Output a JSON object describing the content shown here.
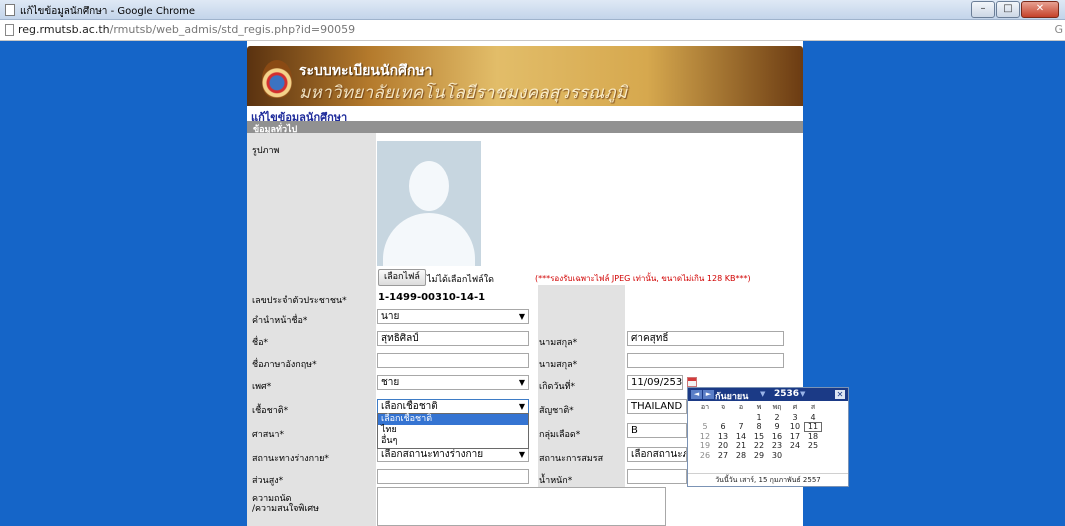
{
  "window": {
    "title": "แก้ไขข้อมูลนักศึกษา - Google Chrome",
    "min": "–",
    "max": "□",
    "close": "✕"
  },
  "address": {
    "host": "reg.rmutsb.ac.th",
    "path": "/rmutsb/web_admis/std_regis.php?id=90059",
    "edge": "G"
  },
  "banner": {
    "title": "ระบบทะเบียนนักศึกษา",
    "subtitle": "มหาวิทยาลัยเทคโนโลยีราชมงคลสุวรรณภูมิ"
  },
  "page": {
    "heading": "แก้ไขข้อมูลนักศึกษา",
    "section": "ข้อมูลทั่วไป"
  },
  "form": {
    "photo_label": "รูปภาพ",
    "file_button": "เลือกไฟล์",
    "file_none": "ไม่ได้เลือกไฟล์ใด",
    "file_note": "(***รองรับเฉพาะไฟล์ JPEG เท่านั้น, ขนาดไม่เกิน 128 KB***)",
    "id_label": "เลขประจำตัวประชาชน*",
    "id_value": "1-1499-00310-14-1",
    "prefix_label": "คำนำหน้าชื่อ*",
    "prefix_value": "นาย",
    "first_label": "ชื่อ*",
    "first_value": "สุทธิศิลป์",
    "last_label": "นามสกุล*",
    "last_value": "ศาคสุทธิ์",
    "first_en_label": "ชื่อภาษาอังกฤษ*",
    "first_en_value": "",
    "last_en_label": "นามสกุล*",
    "last_en_value": "",
    "gender_label": "เพศ*",
    "gender_value": "ชาย",
    "birth_label": "เกิดวันที่*",
    "birth_value": "11/09/2536",
    "race_label": "เชื้อชาติ*",
    "race_value": "เลือกเชื้อชาติ",
    "nationality_label": "สัญชาติ*",
    "nationality_value": "THAILAND",
    "religion_label": "ศาสนา*",
    "blood_label": "กลุ่มเลือด*",
    "blood_value": "B",
    "body_label": "สถานะทางร่างกาย*",
    "body_value": "เลือกสถานะทางร่างกาย",
    "marital_label": "สถานะการสมรส",
    "marital_value": "เลือกสถานะภา",
    "height_label": "ส่วนสูง*",
    "height_value": "",
    "weight_label": "น้ำหนัก*",
    "weight_value": "",
    "interest_label_1": "ความถนัด",
    "interest_label_2": "/ความสนใจพิเศษ",
    "race_options": [
      "เลือกเชื้อชาติ",
      "ไทย",
      "อื่นๆ"
    ]
  },
  "calendar": {
    "prev": "◄",
    "next": "►",
    "month": "กันยายน",
    "year": "2536",
    "close": "✕",
    "weekdays": [
      "อา",
      "จ",
      "อ",
      "พ",
      "พฤ",
      "ศ",
      "ส"
    ],
    "rows": [
      [
        "",
        "",
        "",
        "1",
        "2",
        "3",
        "4"
      ],
      [
        "5",
        "6",
        "7",
        "8",
        "9",
        "10",
        "11"
      ],
      [
        "12",
        "13",
        "14",
        "15",
        "16",
        "17",
        "18"
      ],
      [
        "19",
        "20",
        "21",
        "22",
        "23",
        "24",
        "25"
      ],
      [
        "26",
        "27",
        "28",
        "29",
        "30",
        "",
        ""
      ]
    ],
    "selected_day": "11",
    "footer": "วันนี้วัน เสาร์, 15 กุมภาพันธ์ 2557"
  },
  "colors": {
    "desktop": "#1565c8",
    "heading": "#1f2c9b",
    "calendar_header": "#1b3a86",
    "note": "#d10000"
  }
}
